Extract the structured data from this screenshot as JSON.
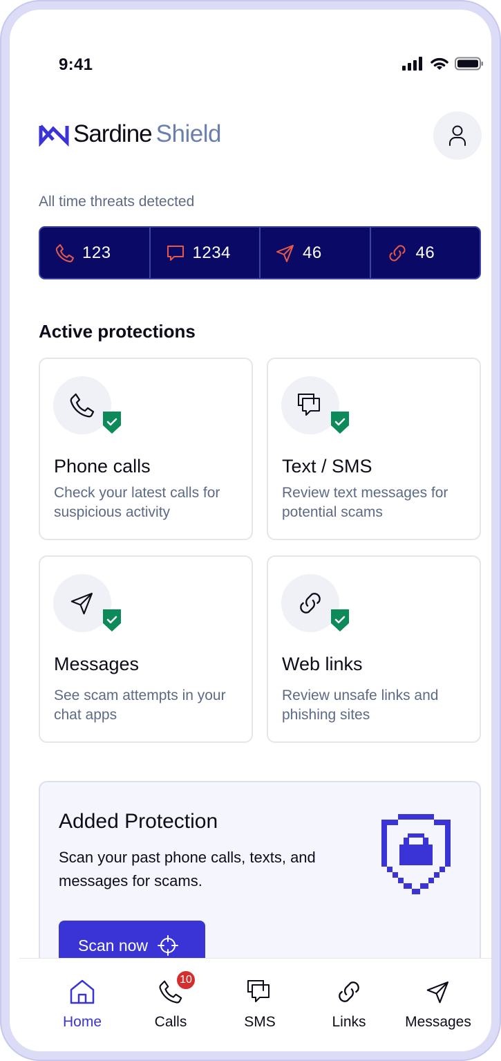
{
  "status_bar": {
    "time": "9:41"
  },
  "header": {
    "brand_primary": "Sardine",
    "brand_secondary": "Shield"
  },
  "threats": {
    "label": "All time threats detected",
    "items": [
      {
        "icon": "phone-icon",
        "value": "123"
      },
      {
        "icon": "chat-icon",
        "value": "1234"
      },
      {
        "icon": "send-icon",
        "value": "46"
      },
      {
        "icon": "link-icon",
        "value": "46"
      }
    ]
  },
  "protections": {
    "title": "Active protections",
    "cards": [
      {
        "icon": "phone-icon",
        "title": "Phone calls",
        "description": "Check your latest calls for suspicious activity"
      },
      {
        "icon": "chat-bubbles-icon",
        "title": "Text / SMS",
        "description": "Review text messages for potential scams"
      },
      {
        "icon": "send-icon",
        "title": "Messages",
        "description": "See scam attempts in your chat apps"
      },
      {
        "icon": "link-icon",
        "title": "Web links",
        "description": "Review unsafe links and phishing sites"
      }
    ]
  },
  "promo": {
    "title": "Added Protection",
    "description": "Scan your past phone calls, texts, and messages for scams.",
    "button_label": "Scan now"
  },
  "tabs": [
    {
      "label": "Home",
      "icon": "home-icon",
      "active": true
    },
    {
      "label": "Calls",
      "icon": "phone-icon",
      "badge": "10"
    },
    {
      "label": "SMS",
      "icon": "chat-bubbles-icon"
    },
    {
      "label": "Links",
      "icon": "link-icon"
    },
    {
      "label": "Messages",
      "icon": "send-icon"
    }
  ],
  "colors": {
    "accent": "#3a33d6",
    "navy": "#0a0a66",
    "threat_icon": "#e8594a",
    "shield_green": "#0c8a5a",
    "badge_red": "#d42f2f"
  }
}
